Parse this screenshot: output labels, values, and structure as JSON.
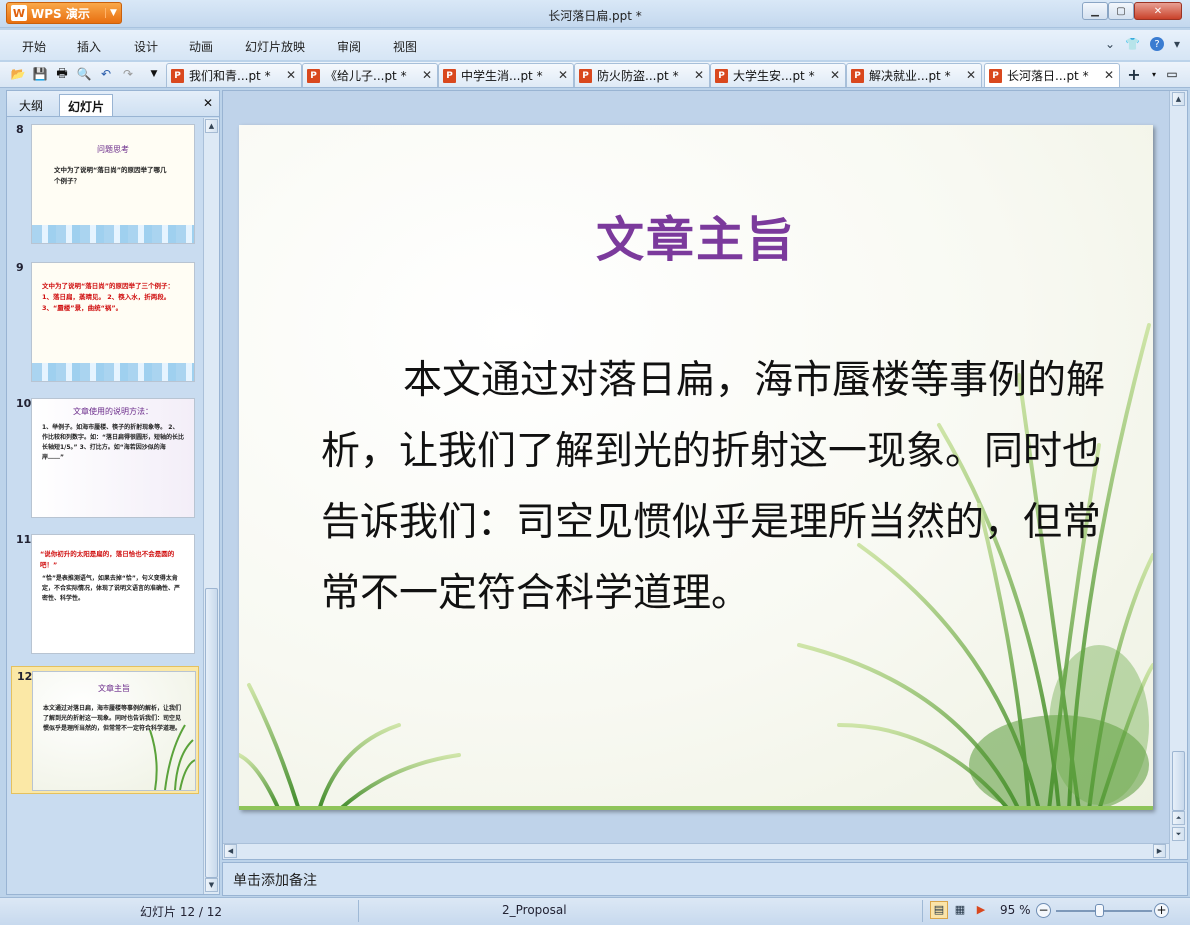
{
  "app": {
    "button_label": "WPS 演示",
    "window_title": "长河落日扁.ppt *"
  },
  "menu": [
    "开始",
    "插入",
    "设计",
    "动画",
    "幻灯片放映",
    "审阅",
    "视图"
  ],
  "doc_tabs": [
    {
      "label": "我们和青...pt *"
    },
    {
      "label": "《给儿子...pt *"
    },
    {
      "label": "中学生消...pt *"
    },
    {
      "label": "防火防盗...pt *"
    },
    {
      "label": "大学生安...pt *"
    },
    {
      "label": "解决就业...pt *"
    },
    {
      "label": "长河落日...pt *"
    }
  ],
  "panel": {
    "tab_outline": "大纲",
    "tab_slides": "幻灯片"
  },
  "thumbnails": [
    {
      "num": "8",
      "title": "问题思考",
      "body": "文中为了说明“落日尚”的原因举了哪几个例子？"
    },
    {
      "num": "9",
      "title": "",
      "body": "文中为了说明“落日尚”的原因举了三个例子： 1、落日扁，蒸晴见。 2、筷入水，折两段。 3、“蜃楼”景，曲统“祸”。"
    },
    {
      "num": "10",
      "title": "文章使用的说明方法：",
      "body": "1、举例子。如海市蜃楼、筷子的折射现象等。 2、作比较和列数字。如：“落日扁得很圆形，短轴的长比长轴短1/5。” 3、打比方。如“海若因沙似的海岸……”"
    },
    {
      "num": "11",
      "title": "“说你初升的太阳是扁的，落日恰也不会是圆的吧！”",
      "body": "“恰”是表推测语气，如果去掉“恰”，句义变得太肯定，不合实际情况，体现了说明文语言的准确性、严密性、科学性。"
    },
    {
      "num": "12",
      "title": "文章主旨",
      "body": "本文通过对落日扁，海市蜃楼等事例的解析，让我们了解到光的折射这一现象。同时也告诉我们：司空见惯似乎是理所当然的，但常常不一定符合科学道理。"
    }
  ],
  "slide": {
    "title": "文章主旨",
    "body": "本文通过对落日扁，海市蜃楼等事例的解析，让我们了解到光的折射这一现象。同时也告诉我们：司空见惯似乎是理所当然的，但常常不一定符合科学道理。",
    "title_color": "#7b3a9c"
  },
  "notes": {
    "placeholder": "单击添加备注"
  },
  "status": {
    "slide_count": "幻灯片 12 / 12",
    "template": "2_Proposal",
    "zoom": "95 %",
    "zoom_percent": 95
  },
  "icons": [
    "open-folder-icon",
    "save-icon",
    "print-icon",
    "print-preview-icon",
    "undo-icon",
    "redo-icon",
    "dropdown-icon",
    "ppt-file-icon",
    "close-icon",
    "new-tab-icon",
    "help-icon",
    "skin-icon"
  ]
}
